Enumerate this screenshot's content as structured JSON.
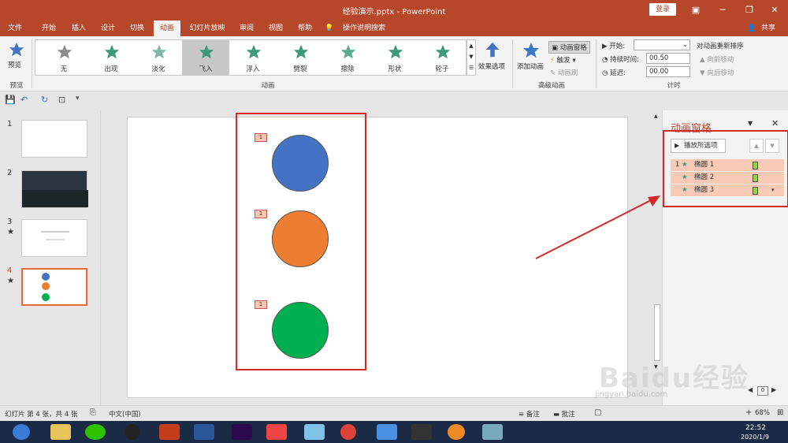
{
  "window": {
    "title": "经验演示.pptx  -  PowerPoint",
    "login": "登录",
    "share": "共享"
  },
  "menu": {
    "tabs": [
      "文件",
      "开始",
      "插入",
      "设计",
      "切换",
      "动画",
      "幻灯片放映",
      "审阅",
      "视图",
      "帮助"
    ],
    "active": "动画",
    "tell_me": "操作说明搜索"
  },
  "ribbon": {
    "preview": {
      "label": "预览",
      "group": "预览"
    },
    "effects": [
      "无",
      "出现",
      "淡化",
      "飞入",
      "浮入",
      "劈裂",
      "擦除",
      "形状",
      "轮子"
    ],
    "selected_effect": "飞入",
    "effect_options": "效果选项",
    "animation_group": "动画",
    "add_animation": "添加动画",
    "animation_pane": "动画窗格",
    "trigger": "触发",
    "anim_painter": "动画刷",
    "advanced_group": "高级动画",
    "start_label": "开始:",
    "duration_label": "持续时间:",
    "duration_value": "00.50",
    "delay_label": "延迟:",
    "delay_value": "00.00",
    "reorder_label": "对动画重新排序",
    "move_earlier": "向前移动",
    "move_later": "向后移动",
    "timing_group": "计时"
  },
  "thumbnails": [
    {
      "num": "1",
      "star": ""
    },
    {
      "num": "2",
      "star": ""
    },
    {
      "num": "3",
      "star": "★"
    },
    {
      "num": "4",
      "star": "★"
    }
  ],
  "slide": {
    "tags": [
      "1",
      "1",
      "1"
    ],
    "circles": [
      {
        "color": "#4472c4"
      },
      {
        "color": "#ed7d31"
      },
      {
        "color": "#00b050"
      }
    ]
  },
  "pane": {
    "title": "动画窗格",
    "play_button": "播放所选项",
    "items": [
      {
        "index": "1",
        "name": "椭圆 1"
      },
      {
        "index": "",
        "name": "椭圆 2"
      },
      {
        "index": "",
        "name": "椭圆 3"
      }
    ]
  },
  "status": {
    "slide_info": "幻灯片 第 4 张，共 4 张",
    "language": "中文(中国)",
    "notes": "备注",
    "comments": "批注",
    "zoom": "68%"
  },
  "taskbar": {
    "time": "22:52",
    "date": "2020/1/9"
  },
  "watermark": {
    "brand": "Baidu经验",
    "url": "jingyan.baidu.com"
  },
  "colors": {
    "accent": "#b7472a",
    "highlight": "#d42a2a"
  }
}
